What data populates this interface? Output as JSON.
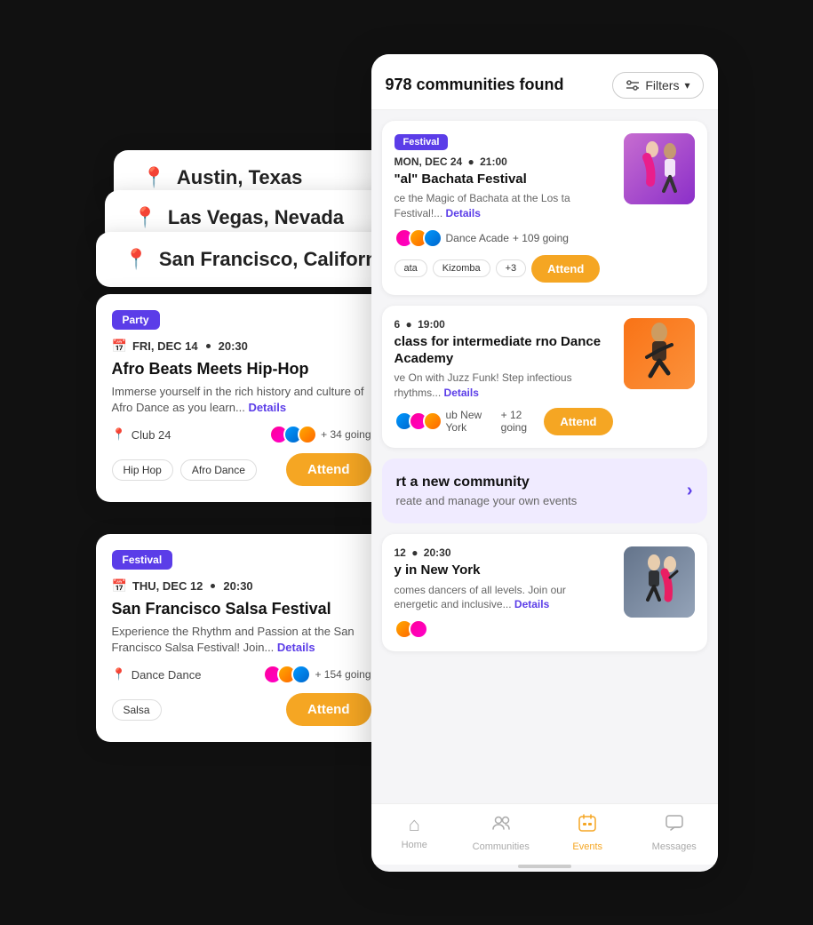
{
  "scene": {
    "locations": [
      {
        "id": "austin",
        "name": "Austin, Texas"
      },
      {
        "id": "vegas",
        "name": "Las Vegas, Nevada"
      },
      {
        "id": "sf",
        "name": "San Francisco, California"
      }
    ],
    "left_cards": [
      {
        "id": "card1",
        "badge": "Party",
        "badge_type": "party",
        "date": "FRI, DEC 14",
        "time": "20:30",
        "title": "Afro Beats Meets Hip-Hop",
        "desc": "Immerse yourself in the rich history and culture of Afro Dance as you learn...",
        "details_label": "Details",
        "venue": "Club 24",
        "attendees_count": "+ 34 going",
        "tags": [
          "Hip Hop",
          "Afro Dance"
        ],
        "attend_label": "Attend",
        "img_class": "img-hiphop"
      },
      {
        "id": "card2",
        "badge": "Festival",
        "badge_type": "festival",
        "date": "THU, DEC 12",
        "time": "20:30",
        "title": "San Francisco Salsa Festival",
        "desc": "Experience the Rhythm and Passion at the San Francisco Salsa Festival! Join...",
        "details_label": "Details",
        "venue": "Dance Dance",
        "attendees_count": "+ 154 going",
        "tags": [
          "Salsa"
        ],
        "attend_label": "Attend",
        "img_class": "img-salsa"
      }
    ]
  },
  "app": {
    "header": {
      "count_text": "978 communities found",
      "filters_label": "Filters"
    },
    "events": [
      {
        "id": "ev1",
        "badge": "Festival",
        "date": "MON, DEC 24",
        "time": "21:00",
        "title": "\"al\" Bachata Festival",
        "desc": "ce the Magic of Bachata at the Los ta Festival!...",
        "details_label": "Details",
        "venue": "Dance Acade",
        "attendees": "+ 109 going",
        "tags": [
          "ata",
          "Kizomba",
          "+3"
        ],
        "attend_label": "Attend",
        "img_class": "img-bachata"
      },
      {
        "id": "ev2",
        "badge": "",
        "date": "6",
        "time": "19:00",
        "title": "class for intermediate rno Dance Academy",
        "desc": "ve On with Juzz Funk! Step infectious rhythms...",
        "details_label": "Details",
        "venue": "ub New York",
        "attendees": "+ 12 going",
        "tags": [],
        "attend_label": "Attend",
        "img_class": "img-funk"
      },
      {
        "id": "ev3",
        "is_start_community": true,
        "title": "rt a new community",
        "desc": "reate and manage your own events"
      },
      {
        "id": "ev4",
        "badge": "",
        "date": "12",
        "time": "20:30",
        "title": "y in New York",
        "desc": "comes dancers of all levels. Join our energetic and inclusive...",
        "details_label": "Details",
        "venue": "",
        "attendees": "",
        "tags": [],
        "attend_label": "",
        "img_class": "img-tango"
      }
    ],
    "nav": {
      "items": [
        {
          "id": "home",
          "label": "Home",
          "icon": "⌂",
          "active": false
        },
        {
          "id": "communities",
          "label": "Communities",
          "icon": "👥",
          "active": false
        },
        {
          "id": "events",
          "label": "Events",
          "icon": "🎫",
          "active": true
        },
        {
          "id": "messages",
          "label": "Messages",
          "icon": "💬",
          "active": false
        }
      ]
    }
  }
}
